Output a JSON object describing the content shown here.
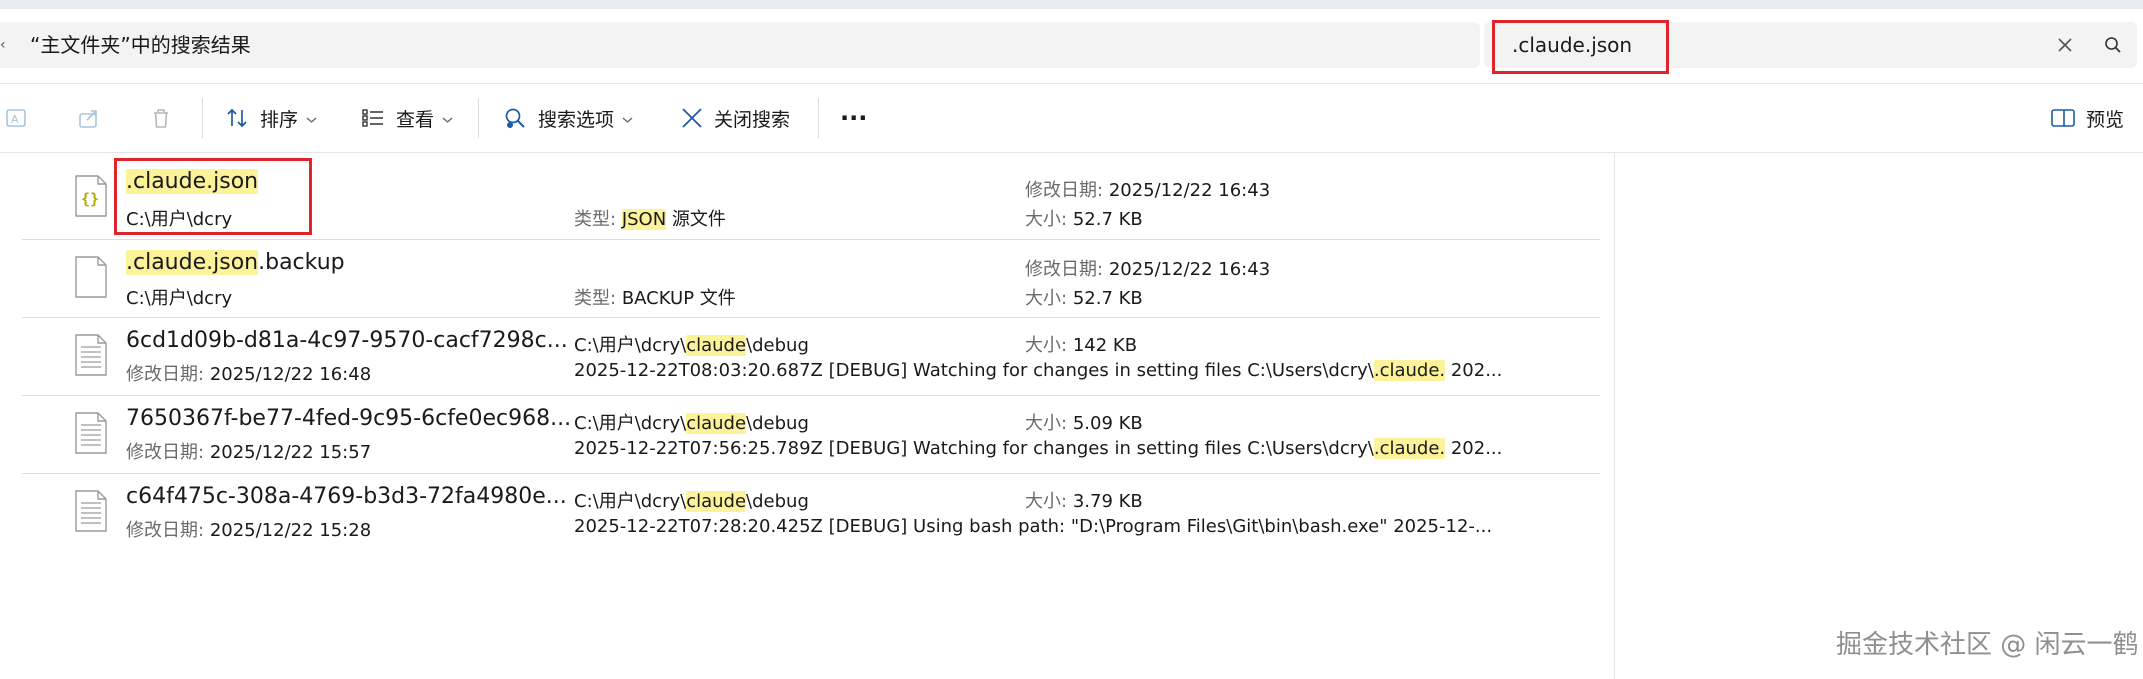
{
  "address": {
    "location_text": "“主文件夹”中的搜索结果"
  },
  "search": {
    "query": ".claude.json",
    "clear_icon": "close-icon",
    "search_icon": "search-icon"
  },
  "toolbar": {
    "sort_label": "排序",
    "view_label": "查看",
    "search_options_label": "搜索选项",
    "close_search_label": "关闭搜索",
    "more_label": "···",
    "preview_label": "预览"
  },
  "results": [
    {
      "icon": "json-file-icon",
      "name_hl": ".claude.json",
      "name_rest": "",
      "path": "C:\\用户\\dcry",
      "type_label": "类型:",
      "type_hl": "JSON",
      "type_rest": " 源文件",
      "date_label": "修改日期:",
      "date": "2025/12/22 16:43",
      "size_label": "大小:",
      "size": "52.7 KB"
    },
    {
      "icon": "file-icon",
      "name_hl": ".claude.json",
      "name_rest": ".backup",
      "path": "C:\\用户\\dcry",
      "type_label": "类型:",
      "type_rest": "BACKUP 文件",
      "date_label": "修改日期:",
      "date": "2025/12/22 16:43",
      "size_label": "大小:",
      "size": "52.7 KB"
    },
    {
      "icon": "text-file-icon",
      "name": "6cd1d09b-d81a-4c97-9570-cacf7298c...",
      "date_label": "修改日期:",
      "date": "2025/12/22 16:48",
      "folder_pre": "C:\\用户\\dcry\\",
      "folder_hl": "claude",
      "folder_post": "\\debug",
      "snippet_pre": "2025-12-22T08:03:20.687Z [DEBUG] Watching for changes in setting files C:\\Users\\dcry\\",
      "snippet_hl": ".claude.",
      "snippet_post": " 202...",
      "size_label": "大小:",
      "size": "142 KB"
    },
    {
      "icon": "text-file-icon",
      "name": "7650367f-be77-4fed-9c95-6cfe0ec968...",
      "date_label": "修改日期:",
      "date": "2025/12/22 15:57",
      "folder_pre": "C:\\用户\\dcry\\",
      "folder_hl": "claude",
      "folder_post": "\\debug",
      "snippet_pre": "2025-12-22T07:56:25.789Z [DEBUG] Watching for changes in setting files C:\\Users\\dcry\\",
      "snippet_hl": ".claude.",
      "snippet_post": " 202...",
      "size_label": "大小:",
      "size": "5.09 KB"
    },
    {
      "icon": "text-file-icon",
      "name": "c64f475c-308a-4769-b3d3-72fa4980e...",
      "date_label": "修改日期:",
      "date": "2025/12/22 15:28",
      "folder_pre": "C:\\用户\\dcry\\",
      "folder_hl": "claude",
      "folder_post": "\\debug",
      "snippet": "2025-12-22T07:28:20.425Z [DEBUG] Using bash path: \"D:\\Program Files\\Git\\bin\\bash.exe\" 2025-12-...",
      "size_label": "大小:",
      "size": "3.79 KB"
    }
  ],
  "watermark": "掘金技术社区 @ 闲云一鹤",
  "colors": {
    "highlight": "#fbf29a",
    "annotation_red": "#e0242c",
    "json_icon": "#b5a800"
  }
}
